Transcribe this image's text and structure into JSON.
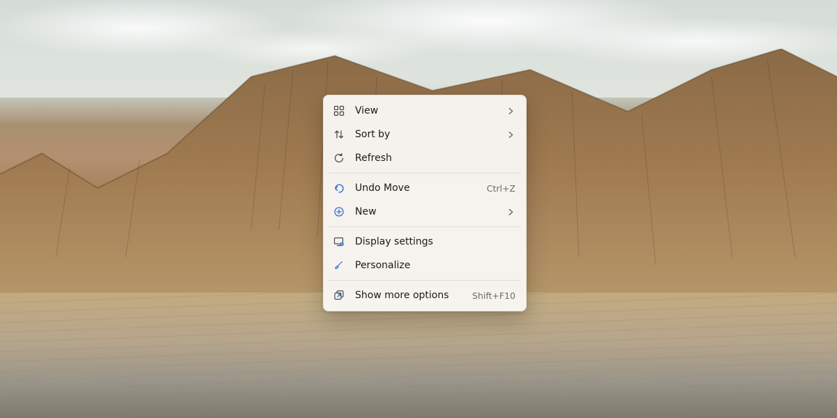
{
  "menu": {
    "groups": [
      [
        {
          "id": "view",
          "label": "View",
          "submenu": true
        },
        {
          "id": "sortby",
          "label": "Sort by",
          "submenu": true
        },
        {
          "id": "refresh",
          "label": "Refresh"
        }
      ],
      [
        {
          "id": "undo",
          "label": "Undo Move",
          "accel": "Ctrl+Z"
        },
        {
          "id": "new",
          "label": "New",
          "submenu": true
        }
      ],
      [
        {
          "id": "display",
          "label": "Display settings"
        },
        {
          "id": "personalize",
          "label": "Personalize"
        }
      ],
      [
        {
          "id": "more",
          "label": "Show more options",
          "accel": "Shift+F10"
        }
      ]
    ]
  }
}
